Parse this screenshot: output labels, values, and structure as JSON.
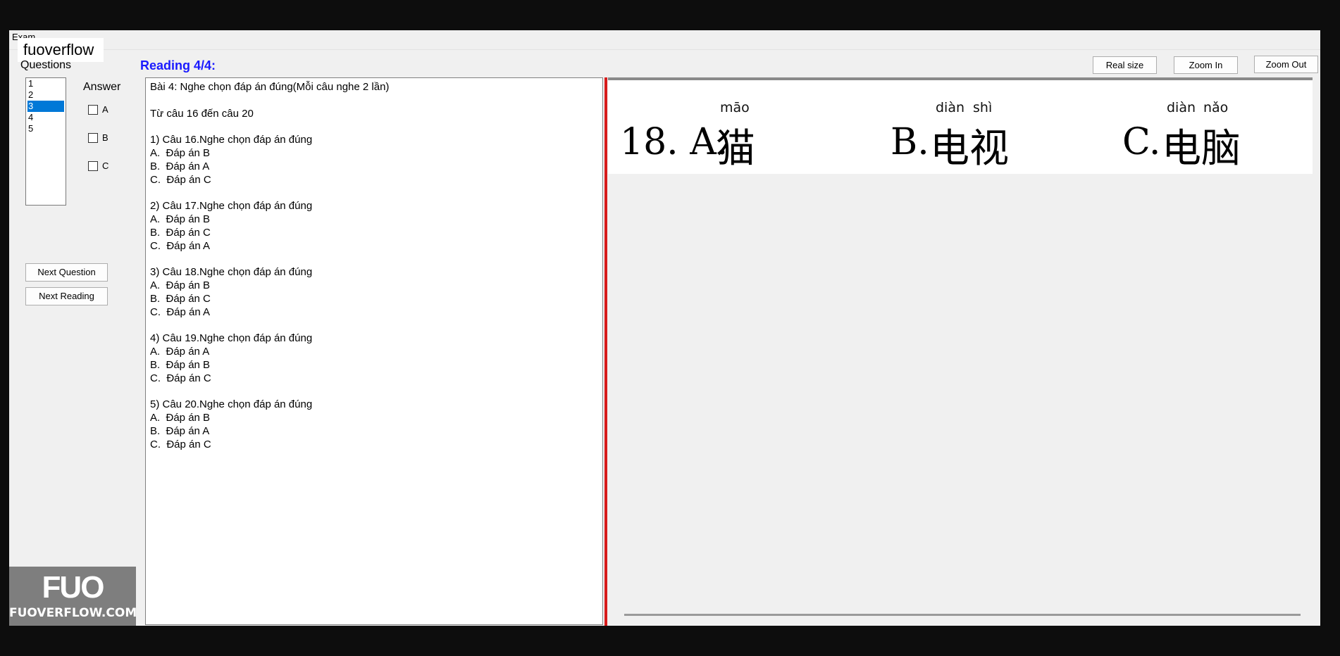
{
  "window": {
    "title": "Exam",
    "watermark": "fuoverflow"
  },
  "left": {
    "questions_label": "Questions",
    "question_items": [
      "1",
      "2",
      "3",
      "4",
      "5"
    ],
    "selected_index": 2,
    "answer_label": "Answer",
    "options": [
      "A",
      "B",
      "C"
    ],
    "next_question": "Next Question",
    "next_reading": "Next Reading"
  },
  "reading_title": "Reading 4/4:",
  "text_lines": [
    "Bài 4: Nghe chọn đáp án đúng(Mỗi câu nghe 2 lần)",
    "",
    "Từ câu 16 đến câu 20",
    "",
    "1) Câu 16.Nghe chọn đáp án đúng",
    "A.  Đáp án B",
    "B.  Đáp án A",
    "C.  Đáp án C",
    "",
    "2) Câu 17.Nghe chọn đáp án đúng",
    "A.  Đáp án B",
    "B.  Đáp án C",
    "C.  Đáp án A",
    "",
    "3) Câu 18.Nghe chọn đáp án đúng",
    "A.  Đáp án B",
    "B.  Đáp án C",
    "C.  Đáp án A",
    "",
    "4) Câu 19.Nghe chọn đáp án đúng",
    "A.  Đáp án A",
    "B.  Đáp án B",
    "C.  Đáp án C",
    "",
    "5) Câu 20.Nghe chọn đáp án đúng",
    "A.  Đáp án B",
    "B.  Đáp án A",
    "C.  Đáp án C"
  ],
  "toolbar": {
    "real_size": "Real size",
    "zoom_in": "Zoom In",
    "zoom_out": "Zoom Out"
  },
  "question_image": {
    "a_label": "18. A.",
    "a_hanzi": "猫",
    "a_pinyin": "māo",
    "b_label": "B.",
    "b_hanzi": "电视",
    "b_pinyin_1": "diàn",
    "b_pinyin_2": "shì",
    "c_label": "C.",
    "c_hanzi": "电脑",
    "c_pinyin_1": "diàn",
    "c_pinyin_2": "nǎo"
  },
  "logo": {
    "mark": "FUO",
    "text": "FUOVERFLOW.COM"
  },
  "colors": {
    "accent_blue": "#1a1aff",
    "selection": "#0078d7",
    "divider_red": "#d61b1b"
  }
}
